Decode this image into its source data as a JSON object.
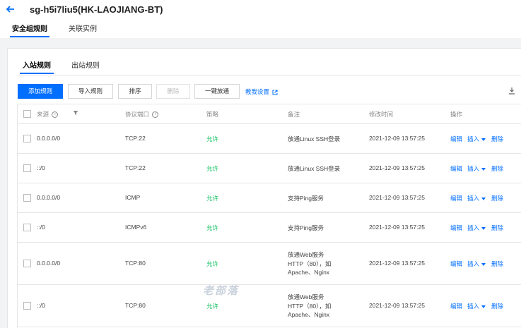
{
  "header": {
    "title": "sg-h5i7liu5(HK-LAOJIANG-BT)",
    "tabs": [
      "安全组规则",
      "关联实例"
    ]
  },
  "rule_tabs": [
    "入站规则",
    "出站规则"
  ],
  "toolbar": {
    "add": "添加规则",
    "import": "导入规则",
    "sort": "排序",
    "delete": "删除",
    "one_click": "一键放通",
    "guide": "教我设置"
  },
  "columns": {
    "source": "来源",
    "protocol": "协议端口",
    "policy": "策略",
    "note": "备注",
    "modified": "修改时间",
    "actions": "操作"
  },
  "row_actions": {
    "edit": "编辑",
    "insert": "插入",
    "delete": "删除"
  },
  "rows": [
    {
      "source": "0.0.0.0/0",
      "protocol": "TCP:22",
      "policy": "允许",
      "note": [
        "放通Linux SSH登录"
      ],
      "modified": "2021-12-09 13:57:25"
    },
    {
      "source": "::/0",
      "protocol": "TCP:22",
      "policy": "允许",
      "note": [
        "放通Linux SSH登录"
      ],
      "modified": "2021-12-09 13:57:25"
    },
    {
      "source": "0.0.0.0/0",
      "protocol": "ICMP",
      "policy": "允许",
      "note": [
        "支持Ping服务"
      ],
      "modified": "2021-12-09 13:57:25"
    },
    {
      "source": "::/0",
      "protocol": "ICMPv6",
      "policy": "允许",
      "note": [
        "支持Ping服务"
      ],
      "modified": "2021-12-09 13:57:25"
    },
    {
      "source": "0.0.0.0/0",
      "protocol": "TCP:80",
      "policy": "允许",
      "note": [
        "放通Web服务",
        "HTTP（80），如",
        "Apache、Nginx"
      ],
      "modified": "2021-12-09 13:57:25"
    },
    {
      "source": "::/0",
      "protocol": "TCP:80",
      "policy": "允许",
      "note": [
        "放通Web服务",
        "HTTP（80），如",
        "Apache、Nginx"
      ],
      "modified": "2021-12-09 13:57:25"
    }
  ],
  "watermark": "老部落",
  "colors": {
    "accent": "#006eff",
    "allow": "#0abf5b"
  }
}
